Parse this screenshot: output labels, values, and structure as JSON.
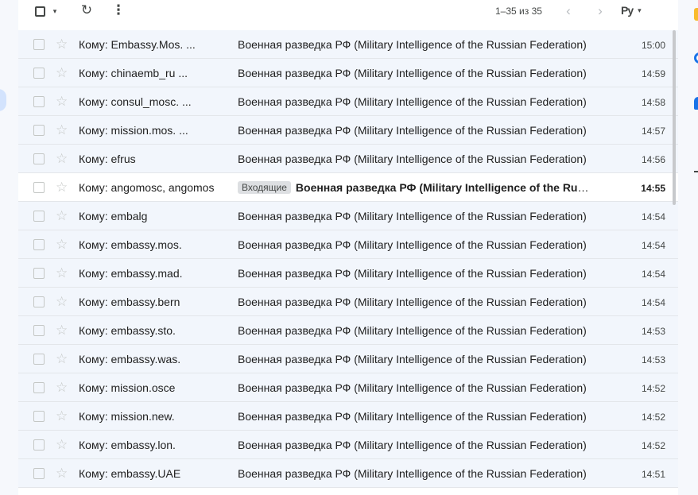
{
  "toolbar": {
    "range_text": "1–35 из 35",
    "select_all_icon": "checkbox-icon",
    "refresh_icon": "↻",
    "more_icon": "⋮",
    "prev_icon": "‹",
    "next_icon": "›",
    "lang_label": "Ру",
    "caret": "▾"
  },
  "emails": [
    {
      "to": "Кому: Embassy.Mos. ...",
      "subject": "Военная разведка РФ (Military Intelligence of the Russian Federation)",
      "time": "15:00",
      "unread": false,
      "label": ""
    },
    {
      "to": "Кому: chinaemb_ru ...",
      "subject": "Военная разведка РФ (Military Intelligence of the Russian Federation)",
      "time": "14:59",
      "unread": false,
      "label": ""
    },
    {
      "to": "Кому: consul_mosc. ...",
      "subject": "Военная разведка РФ (Military Intelligence of the Russian Federation)",
      "time": "14:58",
      "unread": false,
      "label": ""
    },
    {
      "to": "Кому: mission.mos. ...",
      "subject": "Военная разведка РФ (Military Intelligence of the Russian Federation)",
      "time": "14:57",
      "unread": false,
      "label": ""
    },
    {
      "to": "Кому: efrus",
      "subject": "Военная разведка РФ (Military Intelligence of the Russian Federation)",
      "time": "14:56",
      "unread": false,
      "label": ""
    },
    {
      "to": "Кому: angomosc, angomosc",
      "subject": "Военная разведка РФ (Military Intelligence of the Russian Federation)",
      "time": "14:55",
      "unread": true,
      "label": "Входящие"
    },
    {
      "to": "Кому: embalg",
      "subject": "Военная разведка РФ (Military Intelligence of the Russian Federation)",
      "time": "14:54",
      "unread": false,
      "label": ""
    },
    {
      "to": "Кому: embassy.mos.",
      "subject": "Военная разведка РФ (Military Intelligence of the Russian Federation)",
      "time": "14:54",
      "unread": false,
      "label": ""
    },
    {
      "to": "Кому: embassy.mad.",
      "subject": "Военная разведка РФ (Military Intelligence of the Russian Federation)",
      "time": "14:54",
      "unread": false,
      "label": ""
    },
    {
      "to": "Кому: embassy.bern",
      "subject": "Военная разведка РФ (Military Intelligence of the Russian Federation)",
      "time": "14:54",
      "unread": false,
      "label": ""
    },
    {
      "to": "Кому: embassy.sto.",
      "subject": "Военная разведка РФ (Military Intelligence of the Russian Federation)",
      "time": "14:53",
      "unread": false,
      "label": ""
    },
    {
      "to": "Кому: embassy.was.",
      "subject": "Военная разведка РФ (Military Intelligence of the Russian Federation)",
      "time": "14:53",
      "unread": false,
      "label": ""
    },
    {
      "to": "Кому: mission.osce",
      "subject": "Военная разведка РФ (Military Intelligence of the Russian Federation)",
      "time": "14:52",
      "unread": false,
      "label": ""
    },
    {
      "to": "Кому: mission.new.",
      "subject": "Военная разведка РФ (Military Intelligence of the Russian Federation)",
      "time": "14:52",
      "unread": false,
      "label": ""
    },
    {
      "to": "Кому: embassy.lon.",
      "subject": "Военная разведка РФ (Military Intelligence of the Russian Federation)",
      "time": "14:52",
      "unread": false,
      "label": ""
    },
    {
      "to": "Кому: embassy.UAE",
      "subject": "Военная разведка РФ (Military Intelligence of the Russian Federation)",
      "time": "14:51",
      "unread": false,
      "label": ""
    }
  ],
  "icons": {
    "star": "☆",
    "rail_keep": "keep-icon",
    "rail_tasks": "tasks-icon",
    "rail_contacts": "contacts-icon"
  }
}
